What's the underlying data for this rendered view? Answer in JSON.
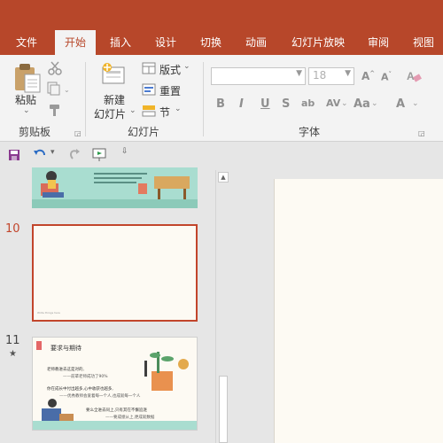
{
  "tabs": [
    "文件",
    "开始",
    "插入",
    "设计",
    "切换",
    "动画",
    "幻灯片放映",
    "审阅",
    "视图"
  ],
  "ribbon": {
    "clipboard": {
      "paste": "粘贴",
      "group_label": "剪贴板"
    },
    "slides": {
      "new_slide_line1": "新建",
      "new_slide_line2": "幻灯片",
      "layout": "版式",
      "reset": "重置",
      "section": "节",
      "group_label": "幻灯片"
    },
    "font": {
      "size_value": "18",
      "bold": "B",
      "italic": "I",
      "underline": "U",
      "strike": "S",
      "shadow": "ab",
      "spacing": "AV",
      "case": "Aa",
      "color": "A",
      "group_label": "字体"
    }
  },
  "slides": [
    {
      "number": "",
      "type": "cover"
    },
    {
      "number": "10",
      "selected": true,
      "footer": "Write things here"
    },
    {
      "number": "11",
      "star": "★",
      "title": "要求与期待",
      "lines": [
        "老师教进去这是对的,",
        "——前辈老师成功了90%",
        "你在成长中付出越多,心中收获也越多,",
        "——优秀教师会爱着每一个人,也成就每一个人",
        "要么全进去同上,只有其在不懈追逐",
        "——要成绩从上,更成就数据"
      ]
    }
  ],
  "colors": {
    "accent": "#b7472a",
    "selected_border": "#c2452b",
    "slide_bg": "#fdfaf3",
    "teal": "#9fd6c8"
  }
}
